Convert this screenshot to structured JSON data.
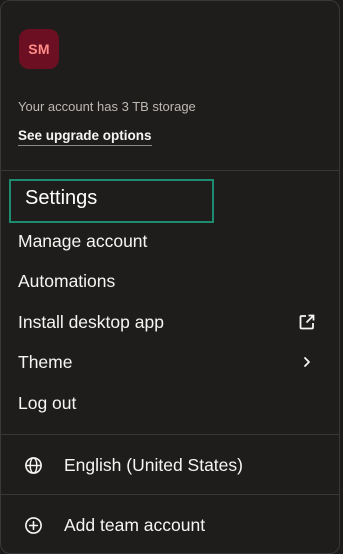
{
  "account": {
    "avatar_initials": "SM",
    "avatar_color": "#6d0f22",
    "storage_text": "Your account has 3 TB storage",
    "upgrade_label": "See upgrade options"
  },
  "menu": {
    "settings_label": "Settings",
    "manage_account_label": "Manage account",
    "automations_label": "Automations",
    "install_desktop_label": "Install desktop app",
    "install_desktop_icon": "external-link-icon",
    "theme_label": "Theme",
    "theme_icon": "chevron-right-icon",
    "logout_label": "Log out"
  },
  "language": {
    "label": "English (United States)",
    "icon": "globe-icon"
  },
  "team": {
    "label": "Add team account",
    "icon": "plus-circle-icon"
  },
  "colors": {
    "background": "#1e1d1c",
    "highlight_border": "#1e8a6f",
    "text": "#f7f5f2",
    "muted_text": "#bdb8b2"
  }
}
